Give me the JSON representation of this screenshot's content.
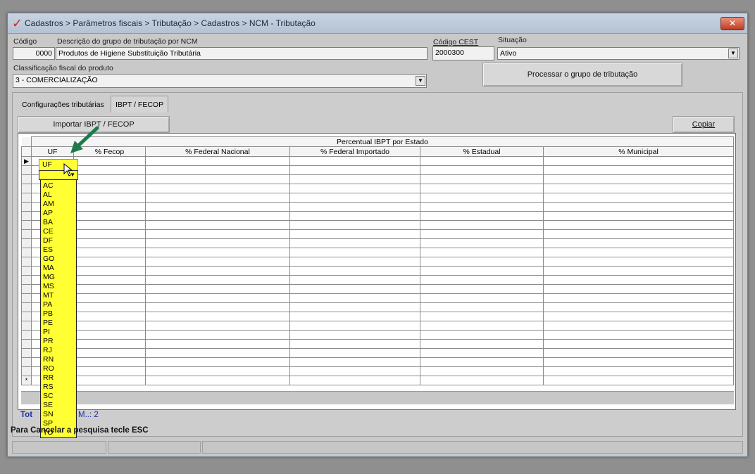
{
  "window": {
    "title": "Cadastros > Parâmetros fiscais > Tributação > Cadastros > NCM - Tributação",
    "close_label": "✕"
  },
  "form": {
    "codigo_label": "Código",
    "codigo_value": "0000",
    "descricao_label": "Descrição do grupo de tributação por NCM",
    "descricao_value": "Produtos de Higiene Substituição Tributária",
    "cest_label": "Código CEST",
    "cest_value": "2000300",
    "situacao_label": "Situação",
    "situacao_value": "Ativo",
    "classificacao_label": "Classificação fiscal do produto",
    "classificacao_value": "3 - COMERCIALIZAÇÃO",
    "processar_label": "Processar o grupo de tributação"
  },
  "tabs": [
    {
      "label": "Configurações tributárias"
    },
    {
      "label": "IBPT / FECOP"
    }
  ],
  "toolbar": {
    "importar_label": "Importar IBPT / FECOP",
    "copiar_label": "Copiar"
  },
  "grid": {
    "group_header": "Percentual IBPT por Estado",
    "columns": [
      "UF",
      "% Fecop",
      "% Federal Nacional",
      "% Federal Importado",
      "% Estadual",
      "% Municipal"
    ],
    "new_row_marker": "*",
    "current_row_marker": "▶"
  },
  "uf_dropdown": {
    "options": [
      "AC",
      "AL",
      "AM",
      "AP",
      "BA",
      "CE",
      "DF",
      "ES",
      "GO",
      "MA",
      "MG",
      "MS",
      "MT",
      "PA",
      "PB",
      "PE",
      "PI",
      "PR",
      "RJ",
      "RN",
      "RO",
      "RR",
      "RS",
      "SC",
      "SE",
      "SN",
      "SP",
      "TO"
    ]
  },
  "footer": {
    "total_prefix": "Tot",
    "total_suffix": "M..: 2",
    "hint": "Para Cancelar a pesquisa tecle ESC"
  },
  "colors": {
    "highlight": "#ffff33",
    "pointer_arrow": "#1f7a4a",
    "link_blue": "#1f2fa0"
  }
}
